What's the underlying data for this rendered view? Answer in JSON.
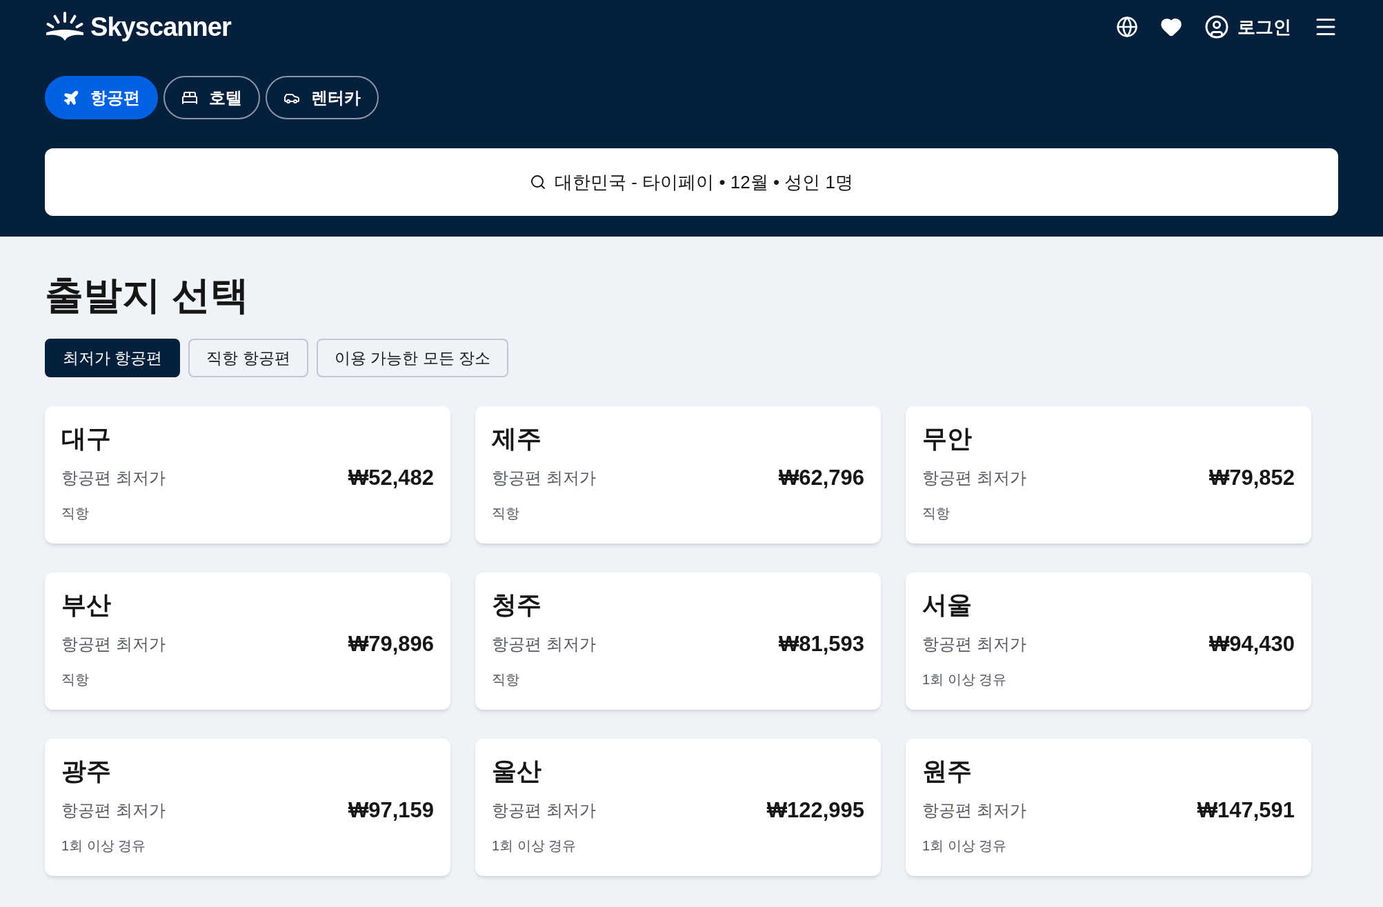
{
  "header": {
    "logo": "Skyscanner",
    "login": "로그인"
  },
  "nav_tabs": [
    {
      "kind": "flight",
      "label": "항공편",
      "selected": true
    },
    {
      "kind": "hotel",
      "label": "호텔",
      "selected": false
    },
    {
      "kind": "car",
      "label": "렌터카",
      "selected": false
    }
  ],
  "search": {
    "value": "대한민국 - 타이페이 • 12월 • 성인 1명"
  },
  "title": "출발지 선택",
  "filters": [
    {
      "label": "최저가 항공편",
      "selected": true
    },
    {
      "label": "직항 항공편",
      "selected": false
    },
    {
      "label": "이용 가능한 모든 장소",
      "selected": false
    }
  ],
  "cards": [
    {
      "city": "대구",
      "label": "항공편 최저가",
      "price": "₩52,482",
      "stops": "직항"
    },
    {
      "city": "제주",
      "label": "항공편 최저가",
      "price": "₩62,796",
      "stops": "직항"
    },
    {
      "city": "무안",
      "label": "항공편 최저가",
      "price": "₩79,852",
      "stops": "직항"
    },
    {
      "city": "부산",
      "label": "항공편 최저가",
      "price": "₩79,896",
      "stops": "직항"
    },
    {
      "city": "청주",
      "label": "항공편 최저가",
      "price": "₩81,593",
      "stops": "직항"
    },
    {
      "city": "서울",
      "label": "항공편 최저가",
      "price": "₩94,430",
      "stops": "1회 이상 경유"
    },
    {
      "city": "광주",
      "label": "항공편 최저가",
      "price": "₩97,159",
      "stops": "1회 이상 경유"
    },
    {
      "city": "울산",
      "label": "항공편 최저가",
      "price": "₩122,995",
      "stops": "1회 이상 경유"
    },
    {
      "city": "원주",
      "label": "항공편 최저가",
      "price": "₩147,591",
      "stops": "1회 이상 경유"
    }
  ]
}
